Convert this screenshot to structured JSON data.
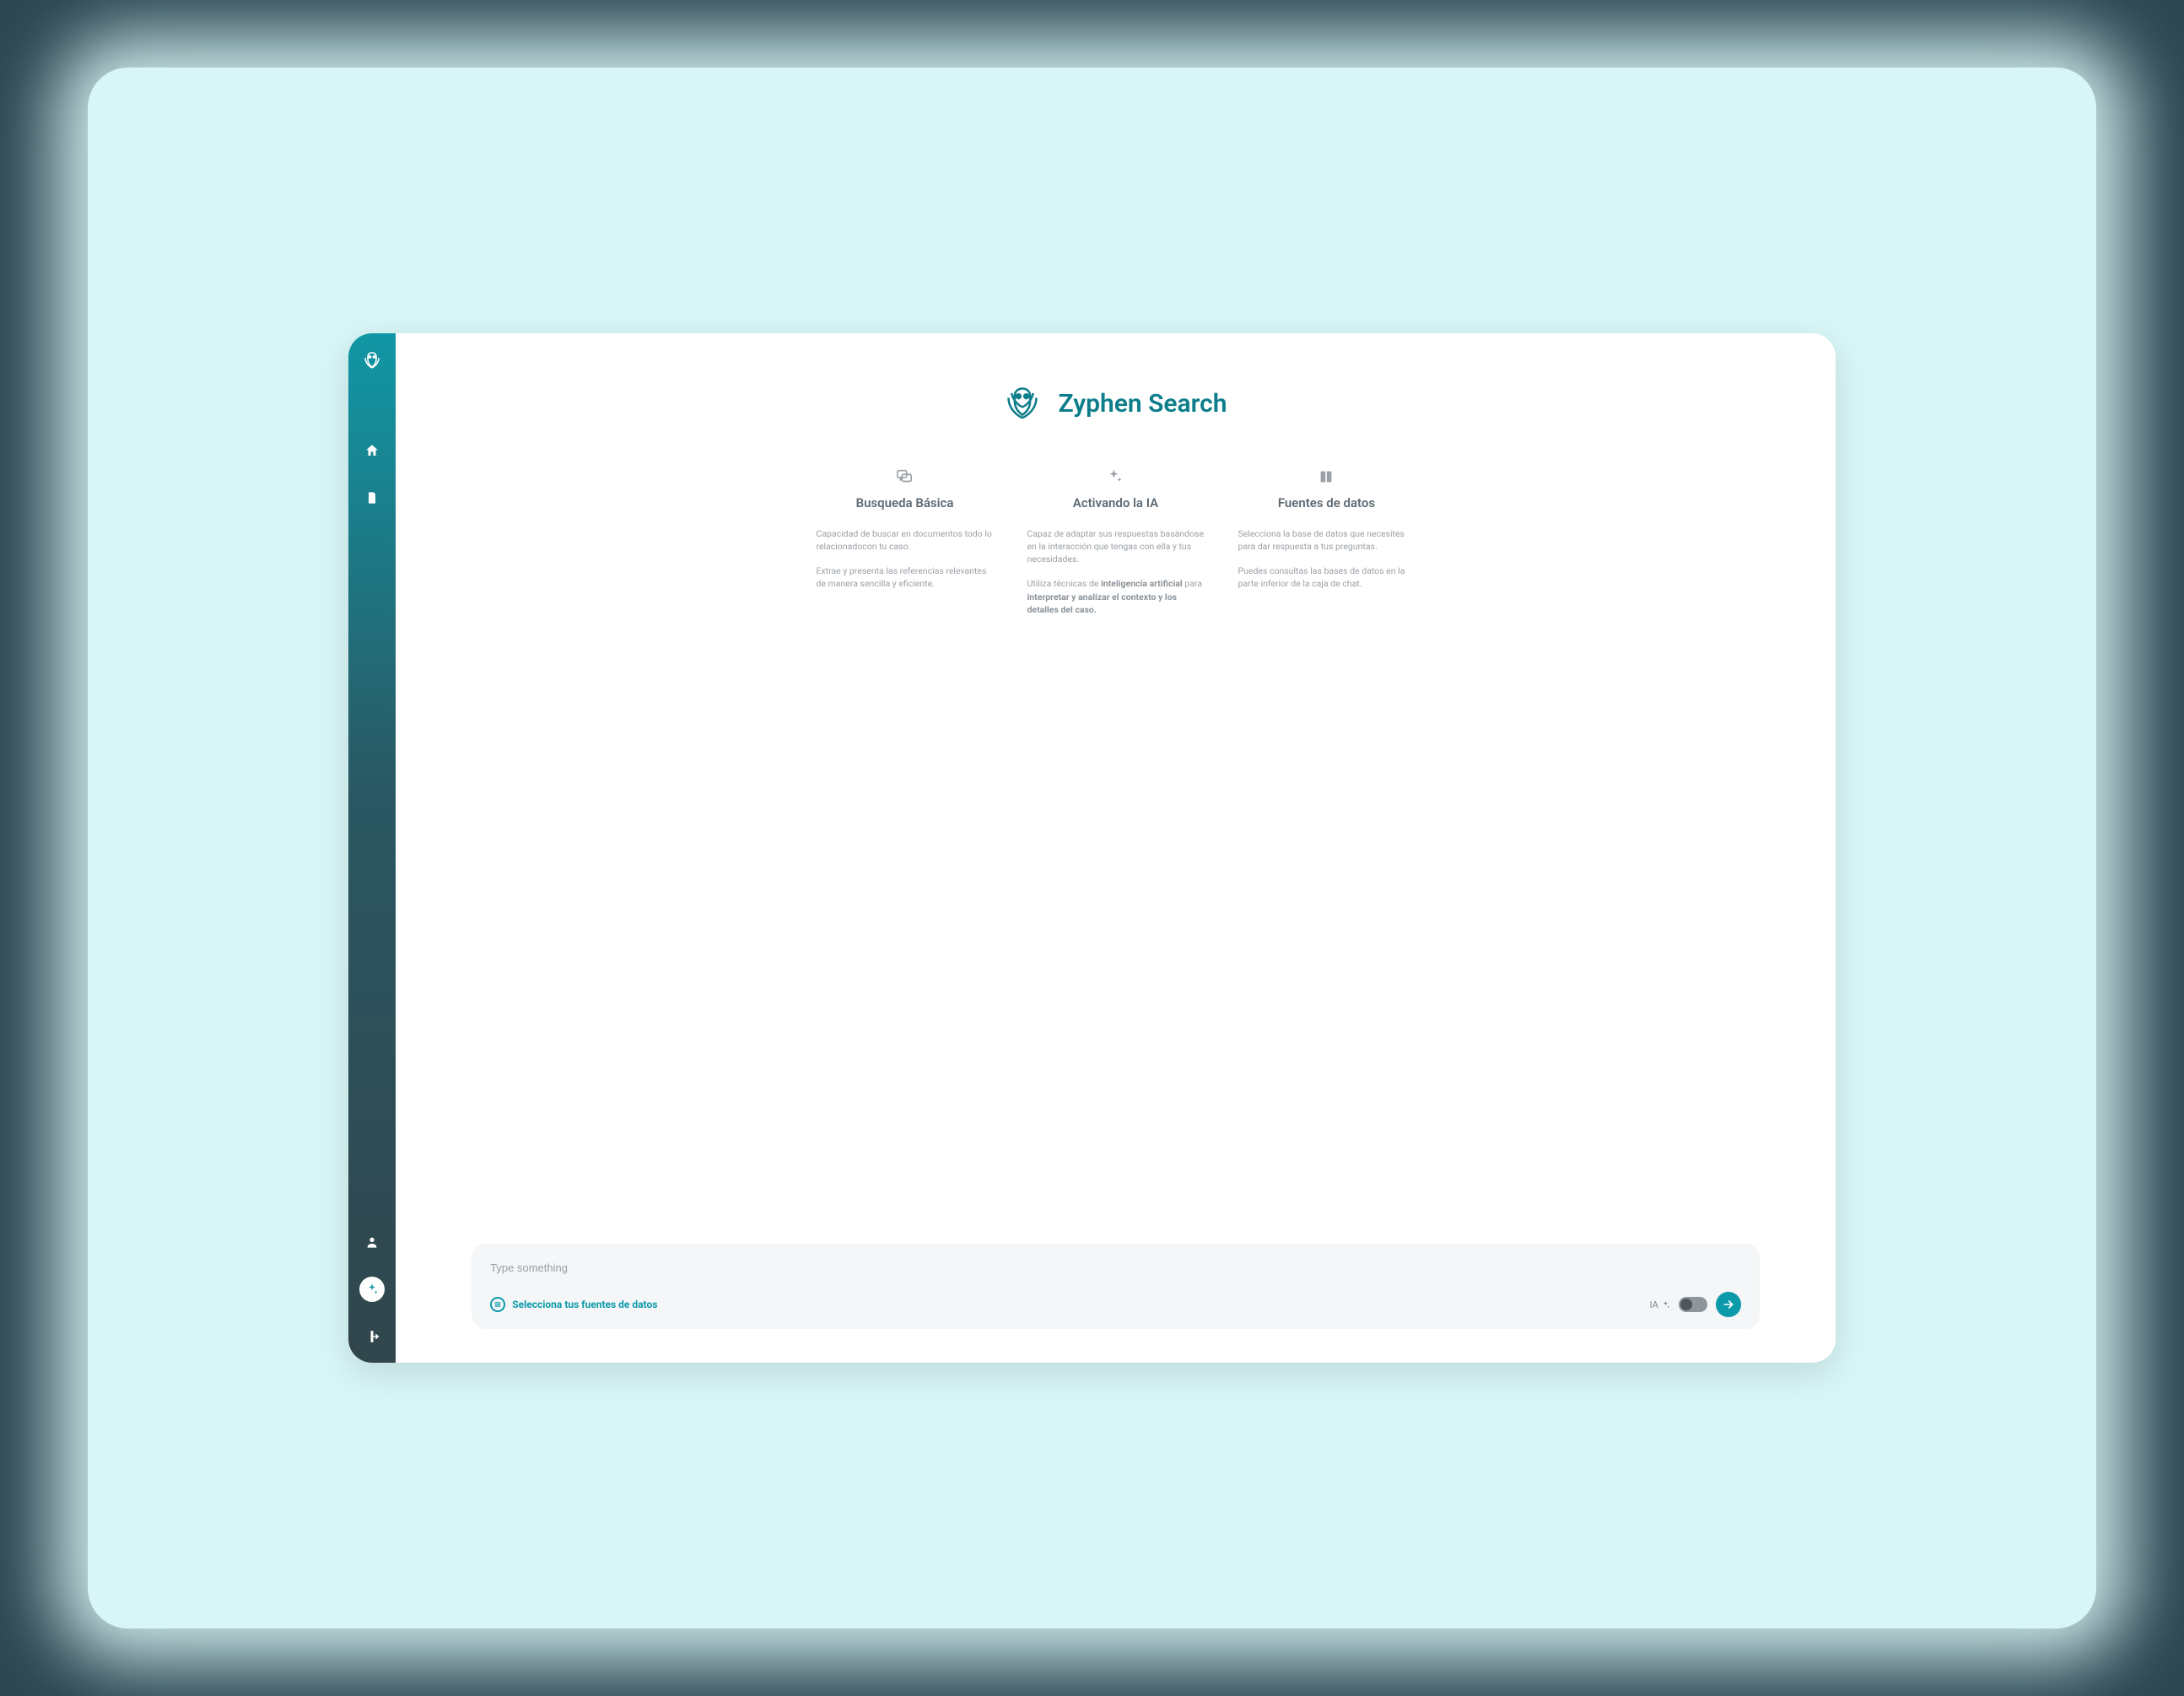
{
  "app": {
    "title": "Zyphen Search"
  },
  "sidebar": {
    "items": [
      "home",
      "document",
      "user",
      "sparkle",
      "logout"
    ]
  },
  "features": [
    {
      "title": "Busqueda Básica",
      "p1": "Capacidad de buscar en documentos todo lo relacionadocon tu caso.",
      "p2": "Extrae y presenta las referencias relevantes de manera sencilla y eficiente."
    },
    {
      "title": "Activando la IA",
      "p1": "Capaz de adaptar sus respuestas basándose en la interacción que tengas con ella y tus necesidades.",
      "p2_pre": "Utiliza técnicas de ",
      "p2_bold1": "inteligencia artificial",
      "p2_mid": " para ",
      "p2_bold2": "interpretar y analizar el contexto y los detalles del caso."
    },
    {
      "title": "Fuentes de datos",
      "p1": "Selecciona la base de datos que necesites para dar respuesta a tus preguntas.",
      "p2": "Puedes consultas las bases de datos en la parte inferior de la caja de chat."
    }
  ],
  "chat": {
    "placeholder": "Type something",
    "db_label": "Selecciona tus fuentes de datos",
    "ia_label": "IA"
  }
}
